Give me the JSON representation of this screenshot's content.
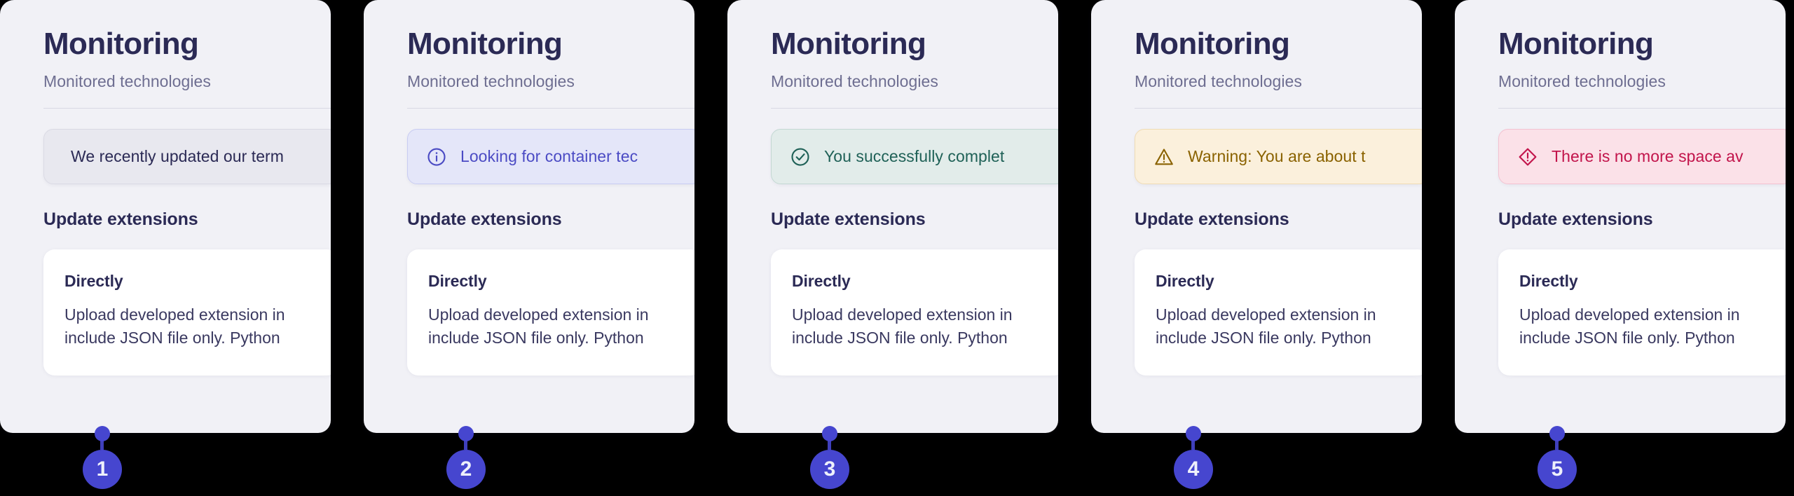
{
  "background_color": "#000000",
  "card": {
    "background_color": "#f1f1f6",
    "title": "Monitoring",
    "subtitle": "Monitored technologies",
    "section_heading": "Update extensions",
    "subcard": {
      "title": "Directly",
      "body": "Upload developed extension in\ninclude JSON file only. Python"
    }
  },
  "accent_color": "#4646cf",
  "panels": [
    {
      "number": "1",
      "alert": {
        "variant": "neutral",
        "icon": null,
        "text": "We recently updated our term",
        "bg": "#e8e8ef",
        "fg": "#2b2a55"
      }
    },
    {
      "number": "2",
      "alert": {
        "variant": "info",
        "icon": "info-circle-icon",
        "text": "Looking for container tec",
        "bg": "#e4e6f9",
        "fg": "#4b4bc4"
      }
    },
    {
      "number": "3",
      "alert": {
        "variant": "success",
        "icon": "check-circle-icon",
        "text": "You successfully complet",
        "bg": "#e2ecea",
        "fg": "#1f6157"
      }
    },
    {
      "number": "4",
      "alert": {
        "variant": "warning",
        "icon": "warning-triangle-icon",
        "text": "Warning: You are about t",
        "bg": "#fbf0dc",
        "fg": "#8a6200"
      }
    },
    {
      "number": "5",
      "alert": {
        "variant": "error",
        "icon": "error-diamond-icon",
        "text": "There is no more space av",
        "bg": "#fbe1e8",
        "fg": "#c2144b"
      }
    }
  ]
}
